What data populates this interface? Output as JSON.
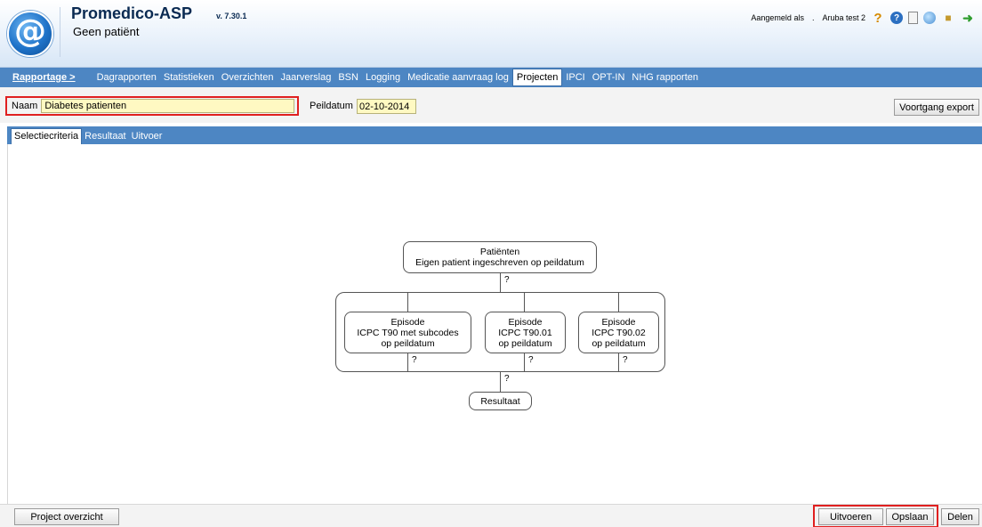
{
  "header": {
    "app_title": "Promedico-ASP",
    "version": "v. 7.30.1",
    "patient_status": "Geen patiënt",
    "logged_in_label": "Aangemeld als",
    "user_sep": ".",
    "user_name": "Aruba test 2",
    "icons": [
      "help-icon",
      "info-icon",
      "document-icon",
      "globe-icon",
      "users-icon",
      "logout-icon"
    ]
  },
  "nav": {
    "main": "Rapportage >",
    "items": [
      {
        "label": "Dagrapporten"
      },
      {
        "label": "Statistieken"
      },
      {
        "label": "Overzichten"
      },
      {
        "label": "Jaarverslag"
      },
      {
        "label": "BSN"
      },
      {
        "label": "Logging"
      },
      {
        "label": "Medicatie aanvraag log"
      },
      {
        "label": "Projecten"
      },
      {
        "label": "IPCI"
      },
      {
        "label": "OPT-IN"
      },
      {
        "label": "NHG rapporten"
      }
    ],
    "active": "Projecten"
  },
  "toolbar": {
    "naam_label": "Naam",
    "naam_value": "Diabetes patienten",
    "peildatum_label": "Peildatum",
    "peildatum_value": "02-10-2014",
    "export_button": "Voortgang export"
  },
  "subtabs": {
    "items": [
      {
        "label": "Selectiecriteria"
      },
      {
        "label": "Resultaat"
      },
      {
        "label": "Uitvoer"
      }
    ],
    "active": "Selectiecriteria"
  },
  "diagram": {
    "root": {
      "line1": "Patiënten",
      "line2": "Eigen patient ingeschreven op peildatum"
    },
    "episodes": [
      {
        "line1": "Episode",
        "line2": "ICPC T90 met subcodes",
        "line3": "op peildatum"
      },
      {
        "line1": "Episode",
        "line2": "ICPC T90.01",
        "line3": "op peildatum"
      },
      {
        "line1": "Episode",
        "line2": "ICPC T90.02",
        "line3": "op peildatum"
      }
    ],
    "result": "Resultaat",
    "question_mark": "?"
  },
  "footer": {
    "project_overview": "Project overzicht",
    "execute": "Uitvoeren",
    "save": "Opslaan",
    "share": "Delen"
  }
}
